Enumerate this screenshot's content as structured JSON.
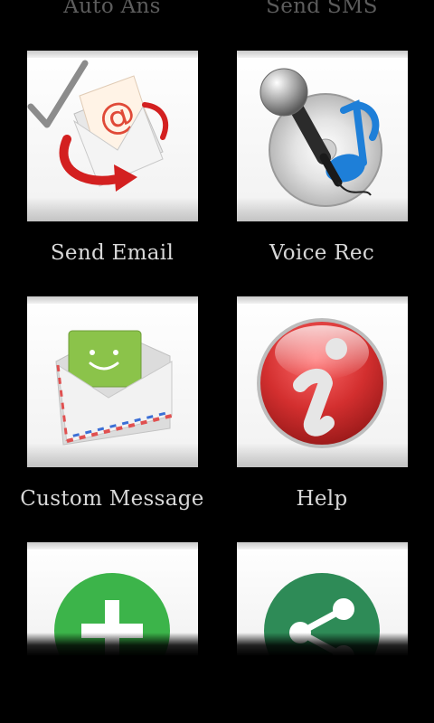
{
  "grid": {
    "partial_labels": {
      "left": "Auto Ans",
      "right": "Send SMS"
    },
    "tiles": [
      {
        "label": "Send Email",
        "icon": "email-envelope-icon"
      },
      {
        "label": "Voice Rec",
        "icon": "microphone-music-icon"
      },
      {
        "label": "Custom Message",
        "icon": "sms-envelope-icon"
      },
      {
        "label": "Help",
        "icon": "info-icon"
      },
      {
        "label": "",
        "icon": "add-plus-icon"
      },
      {
        "label": "",
        "icon": "share-icon"
      }
    ]
  },
  "colors": {
    "background": "#000000",
    "label_text": "#d8d8d8",
    "plus_green": "#3cb44a",
    "share_green": "#2e8b57",
    "help_red": "#d32f2f",
    "email_red": "#e53935"
  }
}
